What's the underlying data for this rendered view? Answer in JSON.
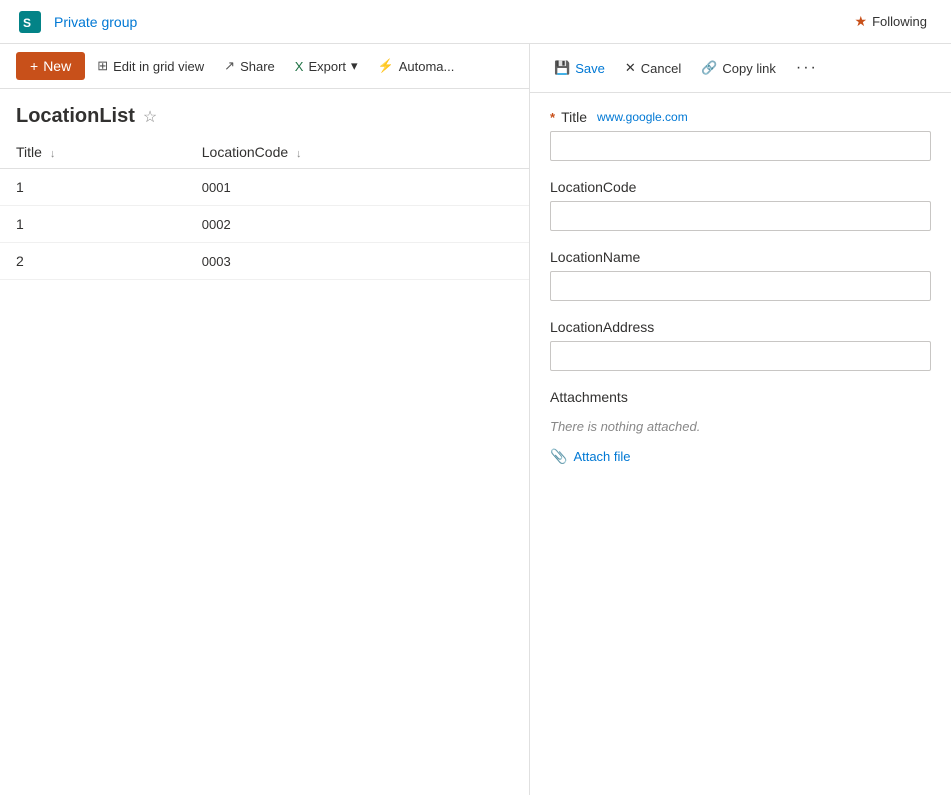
{
  "topbar": {
    "private_group_label": "Private group",
    "following_label": "Following"
  },
  "toolbar": {
    "new_label": "New",
    "edit_grid_label": "Edit in grid view",
    "share_label": "Share",
    "export_label": "Export",
    "automate_label": "Automa..."
  },
  "list": {
    "title": "LocationList",
    "columns": [
      {
        "key": "title",
        "label": "Title",
        "sortable": true
      },
      {
        "key": "location_code",
        "label": "LocationCode",
        "sortable": true
      }
    ],
    "rows": [
      {
        "id": 1,
        "title": "1",
        "location_code": "0001"
      },
      {
        "id": 2,
        "title": "1",
        "location_code": "0002"
      },
      {
        "id": 3,
        "title": "2",
        "location_code": "0003"
      }
    ]
  },
  "form": {
    "save_label": "Save",
    "cancel_label": "Cancel",
    "copy_link_label": "Copy link",
    "more_label": "···",
    "title_field": {
      "label": "Title",
      "required": true,
      "hint": "www.google.com",
      "value": ""
    },
    "location_code_field": {
      "label": "LocationCode",
      "value": ""
    },
    "location_name_field": {
      "label": "LocationName",
      "value": ""
    },
    "location_address_field": {
      "label": "LocationAddress",
      "value": ""
    },
    "attachments": {
      "label": "Attachments",
      "empty_text": "There is nothing attached.",
      "attach_file_label": "Attach file"
    }
  },
  "icons": {
    "save": "💾",
    "cancel": "✕",
    "copy_link": "🔗",
    "new_plus": "+",
    "edit_grid": "⊞",
    "share": "↗",
    "export_excel": "X",
    "automate": "⚡",
    "sort_down": "↓",
    "star_following": "★",
    "star_fav": "☆",
    "paperclip": "📎"
  }
}
